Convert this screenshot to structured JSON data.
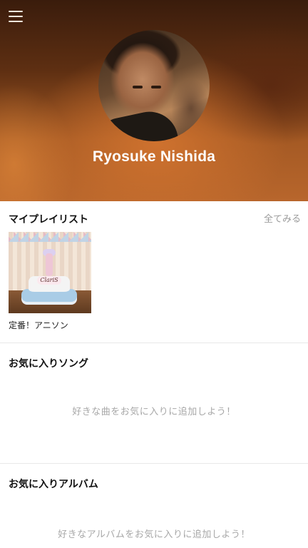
{
  "profile": {
    "name": "Ryosuke Nishida"
  },
  "my_playlists": {
    "title": "マイプレイリスト",
    "see_all": "全てみる",
    "items": [
      {
        "name": "定番！アニソン",
        "cover_text": "ClariS"
      }
    ]
  },
  "favorite_songs": {
    "title": "お気に入りソング",
    "empty_message": "好きな曲をお気に入りに追加しよう！"
  },
  "favorite_albums": {
    "title": "お気に入りアルバム",
    "empty_message": "好きなアルバムをお気に入りに追加しよう！"
  },
  "icons": {
    "menu": "hamburger-menu-icon",
    "avatar": "user-avatar-photo"
  },
  "colors": {
    "header_gradient_top": "#3a1c0c",
    "header_gradient_bottom": "#b8662c",
    "secondary_text": "#9a9a9a",
    "divider": "#e8e8e8"
  }
}
